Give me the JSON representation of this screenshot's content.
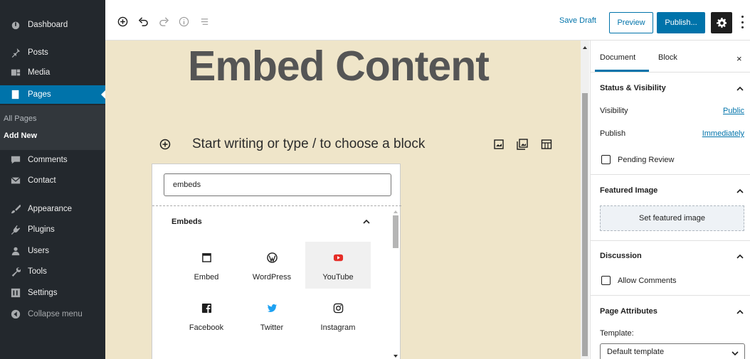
{
  "sidebar": {
    "items": [
      {
        "label": "Dashboard",
        "icon": "dashboard-icon"
      },
      {
        "label": "Posts",
        "icon": "pin-icon"
      },
      {
        "label": "Media",
        "icon": "media-icon"
      },
      {
        "label": "Pages",
        "icon": "page-icon",
        "active": true
      },
      {
        "label": "Comments",
        "icon": "comment-icon"
      },
      {
        "label": "Contact",
        "icon": "mail-icon"
      },
      {
        "label": "Appearance",
        "icon": "brush-icon"
      },
      {
        "label": "Plugins",
        "icon": "plugin-icon"
      },
      {
        "label": "Users",
        "icon": "user-icon"
      },
      {
        "label": "Tools",
        "icon": "wrench-icon"
      },
      {
        "label": "Settings",
        "icon": "settings-icon"
      },
      {
        "label": "Collapse menu",
        "icon": "collapse-icon"
      }
    ],
    "submenu": [
      {
        "label": "All Pages"
      },
      {
        "label": "Add New",
        "current": true
      }
    ]
  },
  "toolbar": {
    "save_draft": "Save Draft",
    "preview": "Preview",
    "publish": "Publish..."
  },
  "editor": {
    "title": "Embed Content",
    "placeholder": "Start writing or type / to choose a block"
  },
  "inserter": {
    "search_value": "embeds",
    "section_title": "Embeds",
    "blocks": [
      {
        "label": "Embed",
        "icon": "embed-icon"
      },
      {
        "label": "WordPress",
        "icon": "wordpress-icon"
      },
      {
        "label": "YouTube",
        "icon": "youtube-icon",
        "highlighted": true
      },
      {
        "label": "Facebook",
        "icon": "facebook-icon"
      },
      {
        "label": "Twitter",
        "icon": "twitter-icon"
      },
      {
        "label": "Instagram",
        "icon": "instagram-icon"
      }
    ]
  },
  "panel": {
    "tabs": {
      "document": "Document",
      "block": "Block"
    },
    "close": "×",
    "status": {
      "title": "Status & Visibility",
      "visibility_label": "Visibility",
      "visibility_value": "Public",
      "publish_label": "Publish",
      "publish_value": "Immediately",
      "pending_review": "Pending Review"
    },
    "featured": {
      "title": "Featured Image",
      "button": "Set featured image"
    },
    "discussion": {
      "title": "Discussion",
      "allow_comments": "Allow Comments"
    },
    "attributes": {
      "title": "Page Attributes",
      "template_label": "Template:",
      "template_value": "Default template"
    }
  },
  "colors": {
    "admin_sidebar": "#23282d",
    "accent": "#0073aa",
    "canvas": "#efe5c9",
    "youtube": "#e52d27",
    "twitter": "#1da1f2",
    "facebook": "#1e1e1e"
  }
}
